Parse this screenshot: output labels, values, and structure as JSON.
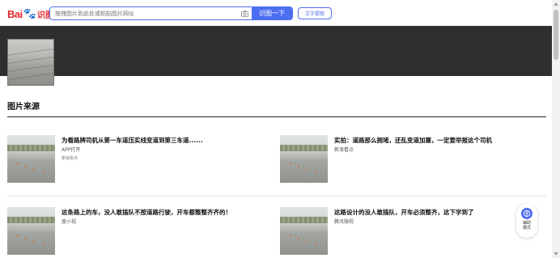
{
  "header": {
    "logo_bai": "Bai",
    "logo_paw": "🐾",
    "logo_shitu": "识图",
    "search_placeholder": "拖拽图片到此处或粘贴图片网址",
    "search_button": "识图一下",
    "text_extract_button": "文字提取"
  },
  "section": {
    "title": "图片来源"
  },
  "cards": [
    {
      "title": "为看路牌司机从第一车道压实线变道到第三车道......",
      "meta1": "APP打开",
      "meta2": "新浪看点"
    },
    {
      "title": "实拍：道路那么拥堵，还乱变道加塞，一定要举报这个司机",
      "meta1": "",
      "meta2": "新浪看点"
    },
    {
      "title": "这条路上的车，没人敢插队不按道路行驶，开车都整整齐齐的！",
      "meta1": "",
      "meta2": "度小视"
    },
    {
      "title": "这路设计的没人敢插队，开车必须整齐，这下学到了",
      "meta1": "",
      "meta2": "腾讯微视"
    }
  ],
  "assist": {
    "label": "辅助模式",
    "icon": "accessibility-icon"
  },
  "colors": {
    "brand_blue": "#4e6ef2",
    "brand_red": "#e4262a",
    "banner": "#2f2f2f"
  }
}
